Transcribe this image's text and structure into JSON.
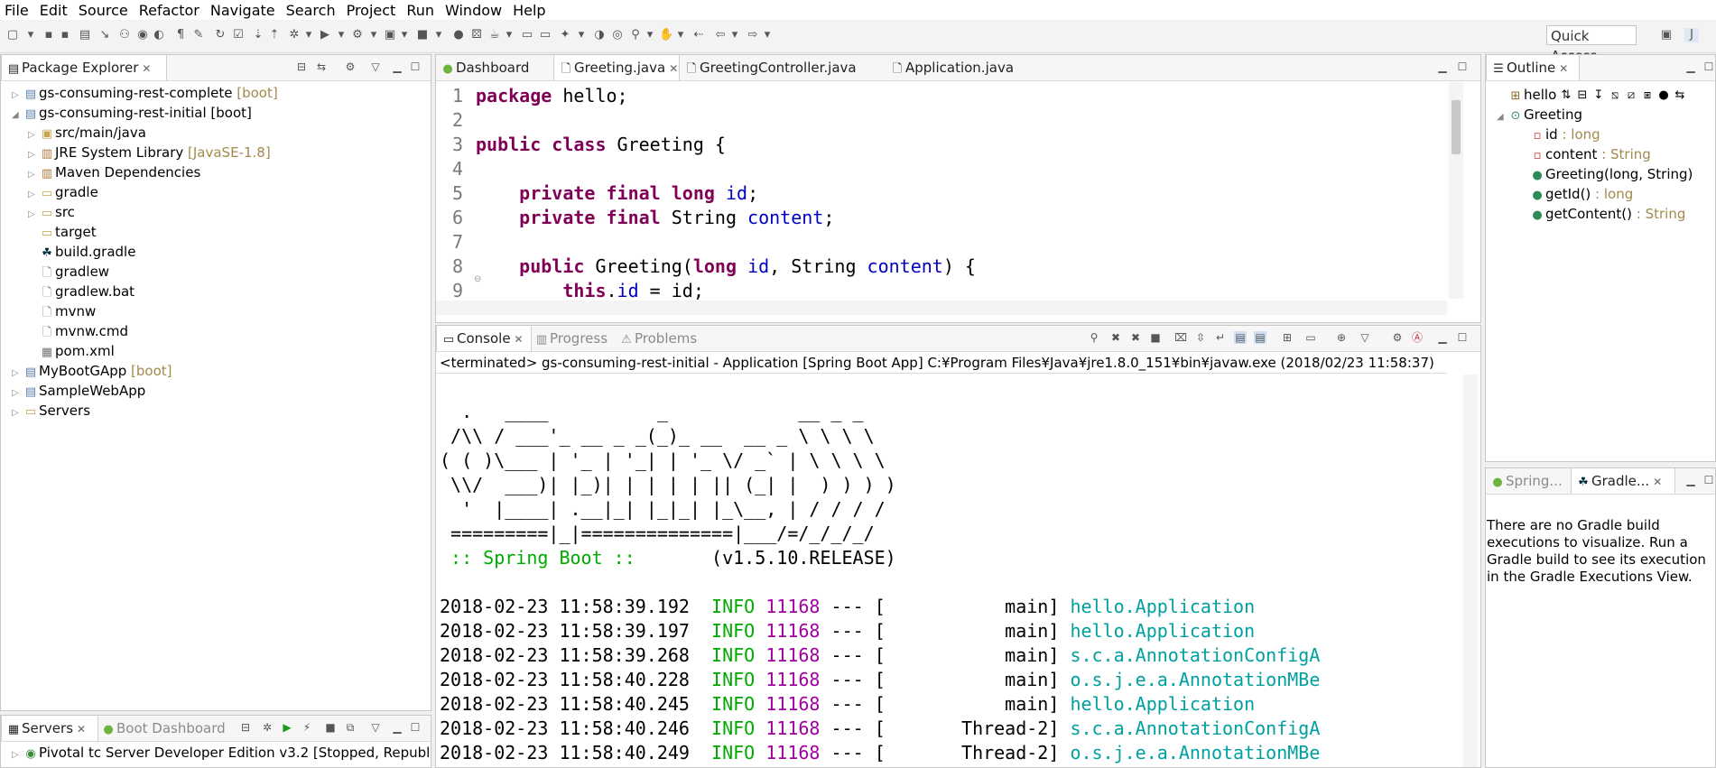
{
  "menu": [
    "File",
    "Edit",
    "Source",
    "Refactor",
    "Navigate",
    "Search",
    "Project",
    "Run",
    "Window",
    "Help"
  ],
  "quick_access": "Quick Access",
  "package_explorer": {
    "tab": "Package Explorer",
    "rows": [
      {
        "label": "gs-consuming-rest-complete",
        "suffix": " [boot]",
        "indent": 0,
        "arrow": "▷",
        "icon": "project-icon"
      },
      {
        "label": "gs-consuming-rest-initial [boot]",
        "suffix": "",
        "indent": 0,
        "arrow": "◢",
        "icon": "project-icon"
      },
      {
        "label": "src/main/java",
        "suffix": "",
        "indent": 1,
        "arrow": "▷",
        "icon": "source-folder-icon"
      },
      {
        "label": "JRE System Library",
        "suffix": " [JavaSE-1.8]",
        "indent": 1,
        "arrow": "▷",
        "icon": "library-icon"
      },
      {
        "label": "Maven Dependencies",
        "suffix": "",
        "indent": 1,
        "arrow": "▷",
        "icon": "library-icon"
      },
      {
        "label": "gradle",
        "suffix": "",
        "indent": 1,
        "arrow": "▷",
        "icon": "folder-icon"
      },
      {
        "label": "src",
        "suffix": "",
        "indent": 1,
        "arrow": "▷",
        "icon": "folder-icon"
      },
      {
        "label": "target",
        "suffix": "",
        "indent": 1,
        "arrow": "",
        "icon": "folder-icon"
      },
      {
        "label": "build.gradle",
        "suffix": "",
        "indent": 1,
        "arrow": "",
        "icon": "gradle-file-icon"
      },
      {
        "label": "gradlew",
        "suffix": "",
        "indent": 1,
        "arrow": "",
        "icon": "file-icon"
      },
      {
        "label": "gradlew.bat",
        "suffix": "",
        "indent": 1,
        "arrow": "",
        "icon": "file-icon"
      },
      {
        "label": "mvnw",
        "suffix": "",
        "indent": 1,
        "arrow": "",
        "icon": "file-icon"
      },
      {
        "label": "mvnw.cmd",
        "suffix": "",
        "indent": 1,
        "arrow": "",
        "icon": "file-icon"
      },
      {
        "label": "pom.xml",
        "suffix": "",
        "indent": 1,
        "arrow": "",
        "icon": "xml-file-icon"
      },
      {
        "label": "MyBootGApp",
        "suffix": " [boot]",
        "indent": 0,
        "arrow": "▷",
        "icon": "project-icon"
      },
      {
        "label": "SampleWebApp",
        "suffix": "",
        "indent": 0,
        "arrow": "▷",
        "icon": "project-icon"
      },
      {
        "label": "Servers",
        "suffix": "",
        "indent": 0,
        "arrow": "▷",
        "icon": "folder-icon"
      }
    ]
  },
  "servers": {
    "tab_servers": "Servers",
    "tab_boot": "Boot Dashboard",
    "row": "Pivotal tc Server Developer Edition v3.2  [Stopped, Republ"
  },
  "editor": {
    "tabs": [
      "Dashboard",
      "Greeting.java",
      "GreetingController.java",
      "Application.java"
    ],
    "line_numbers": [
      "1",
      "2",
      "3",
      "4",
      "5",
      "6",
      "7",
      "8",
      "9"
    ],
    "l1_kw": "package",
    "l1_rest": " hello;",
    "l3_kw": "public class",
    "l3_rest": " Greeting {",
    "l5_kw": "private final long",
    "l5_fld": "id",
    "l5_end": ";",
    "l6_kw": "private final",
    "l6_mid": " String ",
    "l6_fld": "content",
    "l6_end": ";",
    "l8_kw1": "public",
    "l8_mid1": " Greeting(",
    "l8_kw2": "long",
    "l8_mid2": " ",
    "l8_fld1": "id",
    "l8_mid3": ", String ",
    "l8_fld2": "content",
    "l8_end": ") {",
    "l9_kw": "this",
    "l9_mid": ".",
    "l9_fld": "id",
    "l9_end": " = id;"
  },
  "console": {
    "tab_console": "Console",
    "tab_progress": "Progress",
    "tab_problems": "Problems",
    "header": "<terminated> gs-consuming-rest-initial - Application [Spring Boot App] C:¥Program Files¥Java¥jre1.8.0_151¥bin¥javaw.exe (2018/02/23 11:58:37)",
    "banner": [
      "  .   ____          _            __ _ _",
      " /\\\\ / ___'_ __ _ _(_)_ __  __ _ \\ \\ \\ \\",
      "( ( )\\___ | '_ | '_| | '_ \\/ _` | \\ \\ \\ \\",
      " \\\\/  ___)| |_)| | | | | || (_| |  ) ) ) )",
      "  '  |____| .__|_| |_|_| |_\\__, | / / / /",
      " =========|_|==============|___/=/_/_/_/"
    ],
    "spring_label": " :: Spring Boot :: ",
    "spring_version": "      (v1.5.10.RELEASE)",
    "logs": [
      {
        "ts": "2018-02-23 11:58:39.192",
        "level": "INFO",
        "pid": "11168",
        "sep": " --- [",
        "thread": "           main]",
        "logger": "hello.Application"
      },
      {
        "ts": "2018-02-23 11:58:39.197",
        "level": "INFO",
        "pid": "11168",
        "sep": " --- [",
        "thread": "           main]",
        "logger": "hello.Application"
      },
      {
        "ts": "2018-02-23 11:58:39.268",
        "level": "INFO",
        "pid": "11168",
        "sep": " --- [",
        "thread": "           main]",
        "logger": "s.c.a.AnnotationConfigA"
      },
      {
        "ts": "2018-02-23 11:58:40.228",
        "level": "INFO",
        "pid": "11168",
        "sep": " --- [",
        "thread": "           main]",
        "logger": "o.s.j.e.a.AnnotationMBe"
      },
      {
        "ts": "2018-02-23 11:58:40.245",
        "level": "INFO",
        "pid": "11168",
        "sep": " --- [",
        "thread": "           main]",
        "logger": "hello.Application"
      },
      {
        "ts": "2018-02-23 11:58:40.246",
        "level": "INFO",
        "pid": "11168",
        "sep": " --- [",
        "thread": "       Thread-2]",
        "logger": "s.c.a.AnnotationConfigA"
      },
      {
        "ts": "2018-02-23 11:58:40.249",
        "level": "INFO",
        "pid": "11168",
        "sep": " --- [",
        "thread": "       Thread-2]",
        "logger": "o.s.j.e.a.AnnotationMBe"
      }
    ]
  },
  "outline": {
    "tab": "Outline",
    "rows": [
      {
        "name": "hello",
        "type": "",
        "indent": 0,
        "icon": "package-icon"
      },
      {
        "name": "Greeting",
        "type": "",
        "indent": 0,
        "icon": "class-icon"
      },
      {
        "name": "id",
        "type": " : long",
        "indent": 1,
        "icon": "private-field-icon"
      },
      {
        "name": "content",
        "type": " : String",
        "indent": 1,
        "icon": "private-field-icon"
      },
      {
        "name": "Greeting(long, String)",
        "type": "",
        "indent": 1,
        "icon": "constructor-icon"
      },
      {
        "name": "getId()",
        "type": " : long",
        "indent": 1,
        "icon": "public-method-icon"
      },
      {
        "name": "getContent()",
        "type": " : String",
        "indent": 1,
        "icon": "public-method-icon"
      }
    ]
  },
  "gradle": {
    "tab_spring": "Spring...",
    "tab_gradle": "Gradle...",
    "message": "There are no Gradle build executions to visualize. Run a Gradle build to see its execution in the Gradle Executions View."
  }
}
